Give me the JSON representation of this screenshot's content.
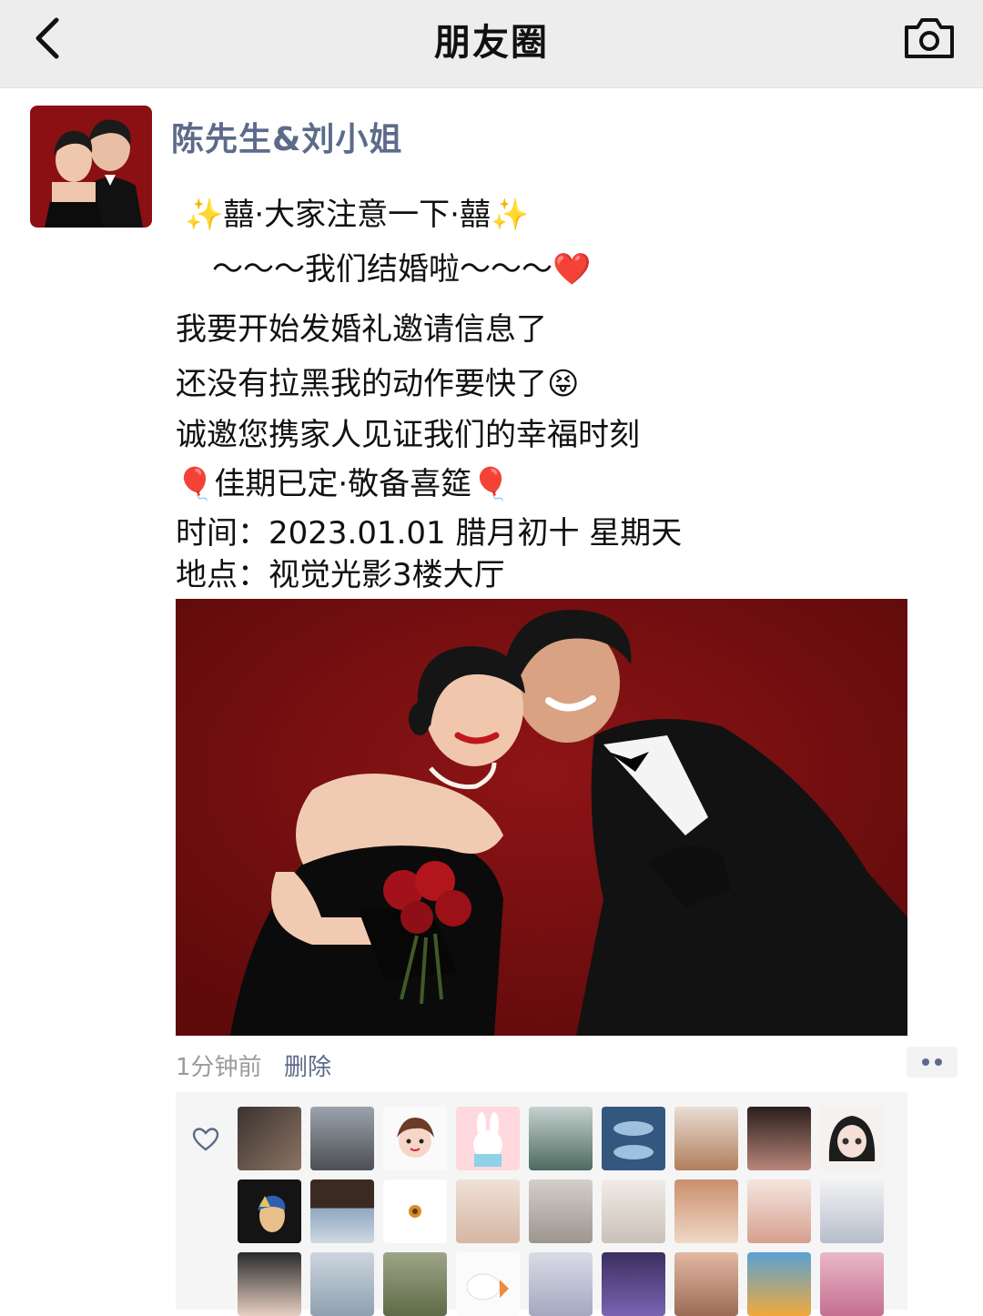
{
  "nav": {
    "title": "朋友圈",
    "back_icon": "chevron-left-icon",
    "camera_icon": "camera-icon"
  },
  "post": {
    "author": "陈先生&刘小姐",
    "lines": [
      "✨囍·大家注意一下·囍✨",
      "～～～我们结婚啦～～～❤️",
      "我要开始发婚礼邀请信息了",
      "还没有拉黑我的动作要快了😝",
      "诚邀您携家人见证我们的幸福时刻",
      "🎈佳期已定·敬备喜筵🎈",
      "时间：2023.01.01 腊月初十 星期天",
      "地点：视觉光影3楼大厅"
    ],
    "time": "1分钟前",
    "delete_label": "删除",
    "photo_background": "#7a0c0e"
  },
  "likes": {
    "icon": "heart-outline-icon",
    "rows": 3,
    "per_row": 9
  },
  "colors": {
    "name_blue": "#5c6b8a",
    "nav_bg": "#ededed",
    "likes_bg": "#f5f5f5"
  }
}
